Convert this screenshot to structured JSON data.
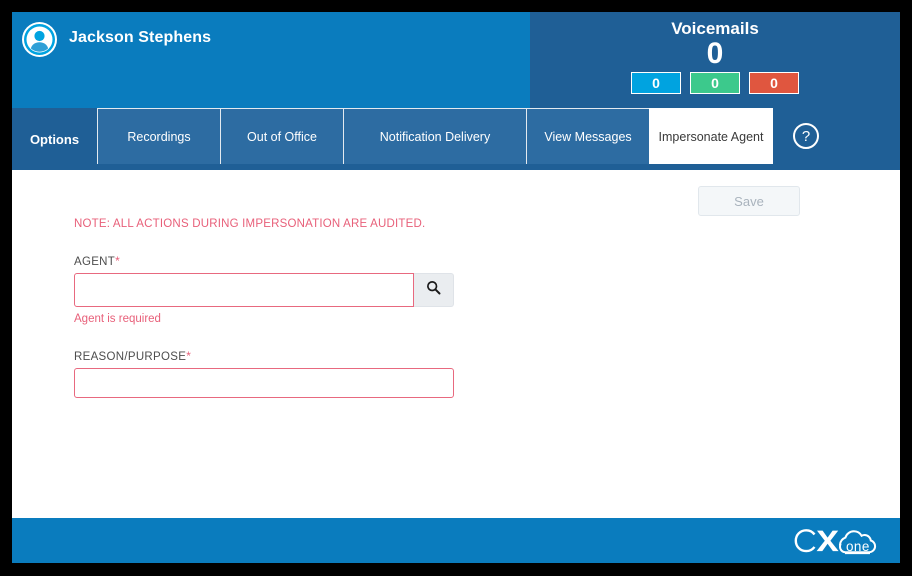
{
  "header": {
    "user_name": "Jackson Stephens",
    "avatar_icon": "user-avatar-icon",
    "voicemails": {
      "title": "Voicemails",
      "total": "0",
      "badges": [
        {
          "value": "0",
          "color": "#00a3e0",
          "name": "new"
        },
        {
          "value": "0",
          "color": "#3cc98c",
          "name": "saved"
        },
        {
          "value": "0",
          "color": "#e0563f",
          "name": "urgent"
        }
      ]
    }
  },
  "tabbar": {
    "options_label": "Options",
    "help_icon_glyph": "?",
    "tabs": [
      {
        "label": "Recordings",
        "active": false
      },
      {
        "label": "Out of Office",
        "active": false
      },
      {
        "label": "Notification Delivery",
        "active": false
      },
      {
        "label": "View Messages",
        "active": false
      },
      {
        "label": "Impersonate Agent",
        "active": true
      }
    ]
  },
  "content": {
    "save_label": "Save",
    "note": "NOTE: ALL ACTIONS DURING IMPERSONATION ARE AUDITED.",
    "agent": {
      "label": "AGENT",
      "required_mark": "*",
      "value": "",
      "placeholder": "",
      "error": "Agent is required",
      "search_icon": "search-icon"
    },
    "reason": {
      "label": "REASON/PURPOSE",
      "required_mark": "*",
      "value": "",
      "placeholder": ""
    }
  },
  "footer": {
    "logo_text_cx": "CX",
    "logo_text_one": "one"
  },
  "colors": {
    "header_left": "#0a7cbe",
    "header_right": "#1f5f96",
    "tab_inactive": "#2d6ca2",
    "accent_red": "#e8607a",
    "footer": "#0a7cbe"
  }
}
